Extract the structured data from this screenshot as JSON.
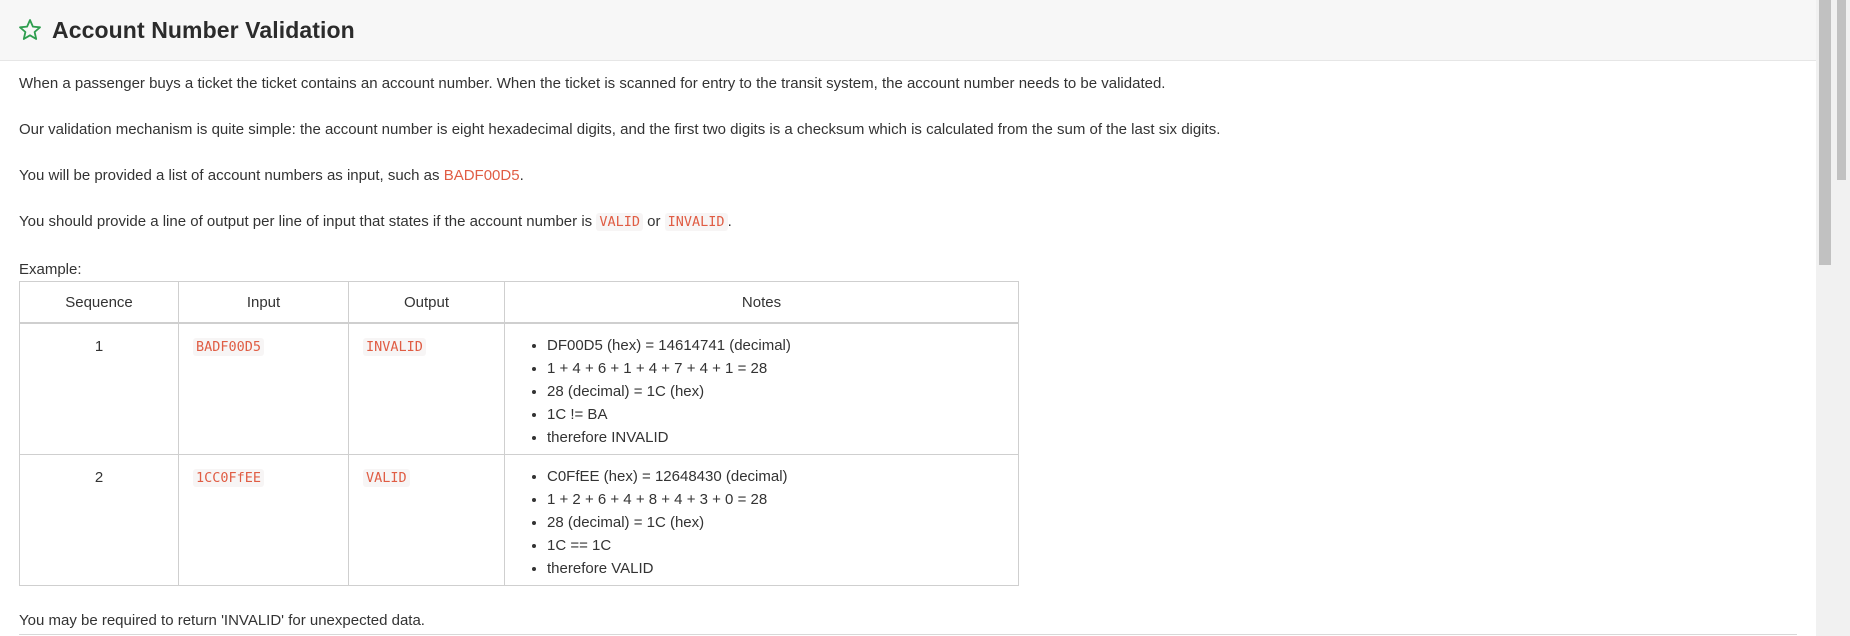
{
  "header": {
    "title": "Account Number Validation",
    "icon": "star-icon"
  },
  "paragraphs": {
    "p1": "When a passenger buys a ticket the ticket contains an account number. When the ticket is scanned for entry to the transit system, the account number needs to be validated.",
    "p2": "Our validation mechanism is quite simple: the account number is eight hexadecimal digits, and the first two digits is a checksum which is calculated from the sum of the last six digits.",
    "p3_before": "You will be provided a list of account numbers as input, such as ",
    "p3_code": "BADF00D5",
    "p3_after": ".",
    "p4_before": "You should provide a line of output per line of input that states if the account number is ",
    "p4_code1": "VALID",
    "p4_mid": " or ",
    "p4_code2": "INVALID",
    "p4_after": ".",
    "example_label": "Example:",
    "footer": "You may be required to return 'INVALID' for unexpected data."
  },
  "table": {
    "headers": [
      "Sequence",
      "Input",
      "Output",
      "Notes"
    ],
    "rows": [
      {
        "sequence": "1",
        "input": "BADF00D5",
        "output": "INVALID",
        "notes": [
          "DF00D5 (hex) = 14614741 (decimal)",
          "1 + 4 + 6 + 1 + 4 + 7 + 4 + 1 = 28",
          "28 (decimal) = 1C (hex)",
          "1C != BA",
          "therefore INVALID"
        ]
      },
      {
        "sequence": "2",
        "input": "1CC0FfEE",
        "output": "VALID",
        "notes": [
          "C0FfEE (hex) = 12648430 (decimal)",
          "1 + 2 + 6 + 4 + 8 + 4 + 3 + 0 = 28",
          "28 (decimal) = 1C (hex)",
          "1C == 1C",
          "therefore VALID"
        ]
      }
    ]
  },
  "colors": {
    "code": "#e05d44",
    "star": "#2e9e4f",
    "header_bg": "#f7f7f7",
    "border": "#cfcfcf"
  }
}
